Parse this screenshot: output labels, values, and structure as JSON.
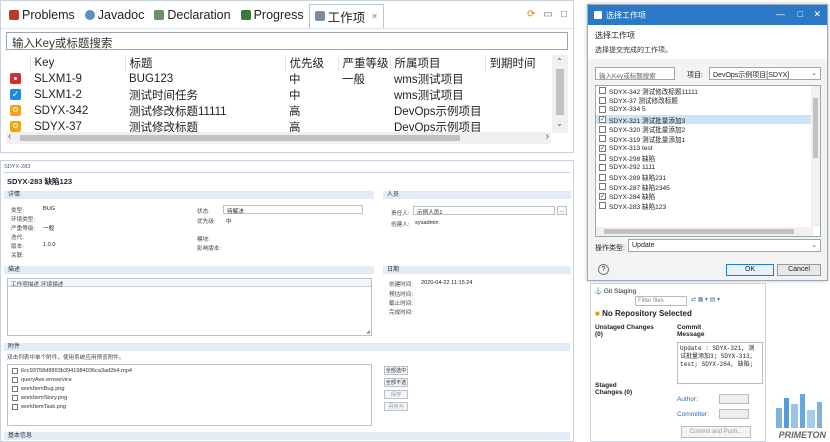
{
  "top_view": {
    "tabs": [
      {
        "label": "Problems",
        "color": "#c0392b"
      },
      {
        "label": "Javadoc",
        "color": "#5a8fc0"
      },
      {
        "label": "Declaration",
        "color": "#6a8f6a"
      },
      {
        "label": "Progress",
        "color": "#3a7a3a"
      },
      {
        "label": "工作项",
        "color": "#7c8fa0",
        "close": "✕"
      }
    ],
    "search_placeholder": "输入Key或标题搜索",
    "columns": [
      "Key",
      "标题",
      "优先级",
      "严重等级",
      "所属项目",
      "到期时间"
    ],
    "rows": [
      {
        "icon_color": "#d32f2f",
        "icon": "bug-icon",
        "key": "SLXM1-9",
        "title": "BUG123",
        "priority": "中",
        "severity": "一般",
        "project": "wms测试项目",
        "due": ""
      },
      {
        "icon_color": "#1e88e5",
        "icon": "task-icon",
        "key": "SLXM1-2",
        "title": "测试时间任务",
        "priority": "中",
        "severity": "",
        "project": "wms测试项目",
        "due": ""
      },
      {
        "icon_color": "#f4a21c",
        "icon": "story-icon",
        "key": "SDYX-342",
        "title": "测试修改标题11111",
        "priority": "高",
        "severity": "",
        "project": "DevOps示例项目",
        "due": ""
      },
      {
        "icon_color": "#f4a21c",
        "icon": "story-icon",
        "key": "SDYX-37",
        "title": "测试修改标题",
        "priority": "高",
        "severity": "",
        "project": "DevOps示例项目",
        "due": ""
      }
    ]
  },
  "detail": {
    "tab": "SDYX-283",
    "title": "SDYX-283 缺陷123",
    "sec_detail": "详情",
    "sec_people": "人员",
    "fields_left": [
      [
        "类型:",
        "BUG"
      ],
      [
        "环境类型:",
        ""
      ],
      [
        "严重等级:",
        "一般"
      ],
      [
        "迭代:",
        ""
      ],
      [
        "版本:",
        "1.0.0"
      ],
      [
        "关联:",
        ""
      ]
    ],
    "fields_mid": [
      [
        "状态:",
        "待解决"
      ],
      [
        "优先级:",
        "中"
      ],
      [
        "",
        ""
      ],
      [
        "模块:",
        ""
      ],
      [
        "影响版本:",
        ""
      ]
    ],
    "assignee_label": "责任人:",
    "assignee": "示例人员1",
    "creator_label": "创建人:",
    "creator": "sysadmin",
    "sec_desc": "描述",
    "sec_date": "日期",
    "desc_tabs": [
      "工作项描述",
      "环境描述"
    ],
    "dates": [
      [
        "创建时间:",
        "2020-04-22 11:15:24"
      ],
      [
        "预估时间:",
        ""
      ],
      [
        "截止时间:",
        ""
      ],
      [
        "完成时间:",
        ""
      ]
    ],
    "sec_attach": "附件",
    "attach_hint": "双击列表中单个附件，使用系统应用预览附件。",
    "files": [
      "6cc93758d8893b3941984036ca3ad2b4.mp4",
      "queryAve.eroservice",
      "workItemBug.png",
      "workItemStory.png",
      "workItemTask.png"
    ],
    "file_buttons": [
      "全部选中",
      "全部不选",
      "保存",
      "另存为"
    ],
    "footer": "基本信息"
  },
  "dialog": {
    "title": "选择工作项",
    "heading": "选择工作项",
    "subtitle": "选择提交完成的工作项。",
    "search_placeholder": "输入Key或标题搜索",
    "project_label": "项目:",
    "project_value": "DevOps示例项目[SDYX]",
    "items": [
      {
        "label": "SDYX-342 测试修改标题11111",
        "checked": false
      },
      {
        "label": "SDYX-37 测试修改标题",
        "checked": false
      },
      {
        "label": "SDYX-334 5",
        "checked": false
      },
      {
        "label": "SDYX-321 测试批量添加3",
        "checked": true,
        "selected": true
      },
      {
        "label": "SDYX-320 测试批量添加2",
        "checked": false
      },
      {
        "label": "SDYX-319 测试批量添加1",
        "checked": false
      },
      {
        "label": "SDYX-313 test",
        "checked": true
      },
      {
        "label": "SDYX-298 缺陷",
        "checked": false
      },
      {
        "label": "SDYX-292 1111",
        "checked": false
      },
      {
        "label": "SDYX-289 缺陷231",
        "checked": false
      },
      {
        "label": "SDYX-287 缺陷2345",
        "checked": false
      },
      {
        "label": "SDYX-284 缺陷",
        "checked": true
      },
      {
        "label": "SDYX-283 缺陷123",
        "checked": false
      }
    ],
    "op_label": "操作类型:",
    "op_value": "Update",
    "ok": "OK",
    "cancel": "Cancel",
    "help": "?"
  },
  "git": {
    "tab": "Git Staging",
    "filter_placeholder": "Filter files",
    "heading": "No Repository Selected",
    "unstaged": "Unstaged Changes (0)",
    "commit": "Commit Message",
    "message": "Update : SDYX-321, 测试批量添加3; SDYX-313, test; SDYX-284, 缺陷;",
    "staged": "Staged Changes (0)",
    "author": "Author:",
    "committer": "Committer:",
    "commit_push": "Commit and Push..."
  },
  "brand": "PRIMETON"
}
